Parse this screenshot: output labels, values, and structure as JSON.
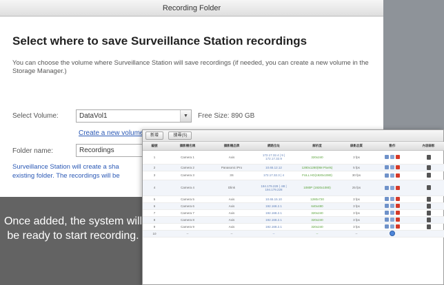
{
  "main_window": {
    "title": "Recording Folder",
    "heading": "Select where to save Surveillance Station recordings",
    "description": "You can choose the volume where Surveillance Station will save recordings (if needed, you can create a new volume in the Storage Manager.)",
    "volume_label": "Select Volume:",
    "volume_value": "DataVol1",
    "free_size": "Free Size: 890 GB",
    "create_volume_link": "Create a new volume in the Storage Manager",
    "folder_label": "Folder name:",
    "folder_value": "Recordings",
    "note_line1": "Surveillance Station will create a sha",
    "note_line2": "existing folder. The recordings will be"
  },
  "overlay_text": "Once added, the system will be ready to start recording.",
  "camera_window": {
    "toolbar": {
      "add_label": "新增",
      "search_label": "搜尋(S)"
    },
    "columns": [
      "編號",
      "攝影機名稱",
      "攝影機品牌",
      "網路位址",
      "解析度",
      "錄影品質",
      "動作",
      "內容錄影"
    ],
    "rows": [
      {
        "no": "1",
        "name": "Camera 1",
        "brand": "Axis",
        "ip": "172.17.32.4 | 9 | 172.17.32.9",
        "res": "320x240",
        "fps": "3 fps"
      },
      {
        "no": "2",
        "name": "Camera 2",
        "brand": "Panasonic iPro",
        "ip": "10.65.12.12",
        "res": "1280x1280(9M Pixels)",
        "fps": "5 fps"
      },
      {
        "no": "3",
        "name": "Camera 3",
        "brand": "3S",
        "ip": "172.17.32.3 | 4",
        "res": "FULL HD(1920x1080)",
        "fps": "30 fps"
      },
      {
        "no": "4",
        "name": "Camera 4",
        "brand": "Dlink",
        "ip": "194.179.228 | .88 | 194.179.228",
        "res": "1080P (1920x1080)",
        "fps": "25 fps"
      },
      {
        "no": "5",
        "name": "Camera 5",
        "brand": "Axis",
        "ip": "10.65.15.10",
        "res": "1280x720",
        "fps": "3 fps"
      },
      {
        "no": "6",
        "name": "Camera 6",
        "brand": "Axis",
        "ip": "192.168.2.1",
        "res": "640x480",
        "fps": "3 fps"
      },
      {
        "no": "7",
        "name": "Camera 7",
        "brand": "Axis",
        "ip": "192.168.2.1",
        "res": "320x240",
        "fps": "3 fps"
      },
      {
        "no": "8",
        "name": "Camera 8",
        "brand": "Axis",
        "ip": "192.168.2.1",
        "res": "320x240",
        "fps": "3 fps"
      },
      {
        "no": "9",
        "name": "Camera 9",
        "brand": "Axis",
        "ip": "192.168.2.1",
        "res": "320x240",
        "fps": "3 fps"
      },
      {
        "no": "10",
        "name": "--",
        "brand": "--",
        "ip": "--",
        "res": "--",
        "fps": "--"
      }
    ]
  }
}
